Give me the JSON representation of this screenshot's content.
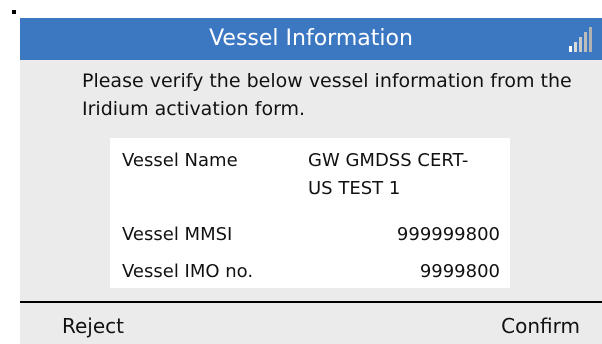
{
  "header": {
    "title": "Vessel Information",
    "signal_icon": "signal-strength-icon"
  },
  "colors": {
    "title_bar": "#3c77c2",
    "screen_bg": "#ebebeb",
    "table_bg": "#ffffff"
  },
  "instructions": "Please verify the below vessel information from the Iridium activation form.",
  "vessel": {
    "name_label": "Vessel Name",
    "name_value": "GW GMDSS CERT-US TEST 1",
    "mmsi_label": "Vessel MMSI",
    "mmsi_value": "999999800",
    "imo_label": "Vessel IMO no.",
    "imo_value": "9999800"
  },
  "softkeys": {
    "left": "Reject",
    "right": "Confirm"
  }
}
